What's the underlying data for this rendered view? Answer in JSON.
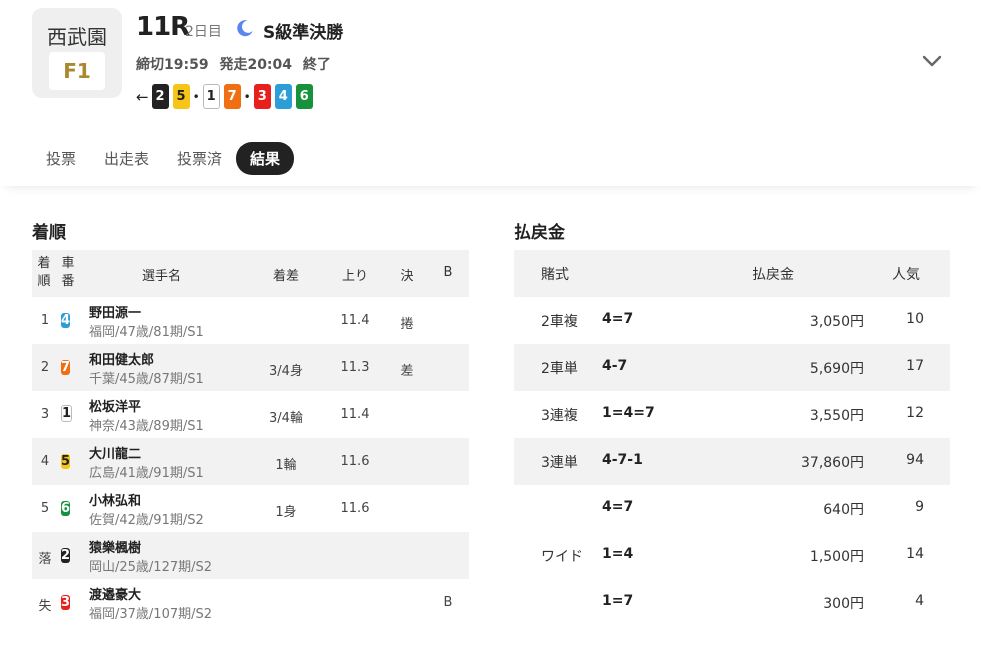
{
  "header": {
    "venue": "西武園",
    "grade": "F1",
    "race_no": "11R",
    "day": "2日目",
    "race_name": "S級準決勝",
    "deadline": "締切19:59",
    "start": "発走20:04",
    "status": "終了",
    "lineup_arrow": "←",
    "lineup": [
      {
        "car": "2",
        "color": "#222222"
      },
      {
        "car": "5",
        "color": "#f7c518"
      },
      {
        "sep": "•"
      },
      {
        "car": "1",
        "color": "#ffffff"
      },
      {
        "car": "7",
        "color": "#f06e14"
      },
      {
        "sep": "•"
      },
      {
        "car": "3",
        "color": "#e8201d"
      },
      {
        "car": "4",
        "color": "#2b9ed8"
      },
      {
        "car": "6",
        "color": "#17923c"
      }
    ]
  },
  "tabs": [
    "投票",
    "出走表",
    "投票済",
    "結果"
  ],
  "active_tab": "結果",
  "results": {
    "title": "着順",
    "headers": {
      "rank": "着\n順",
      "car": "車\n番",
      "name": "選手名",
      "margin": "着差",
      "last": "上り",
      "decision": "決",
      "b": "B"
    },
    "rows": [
      {
        "rank": "1",
        "car": "4",
        "name": "野田源一",
        "info": "福岡/47歳/81期/S1",
        "margin": "",
        "last": "11.4",
        "decision": "捲",
        "b": ""
      },
      {
        "rank": "2",
        "car": "7",
        "name": "和田健太郎",
        "info": "千葉/45歳/87期/S1",
        "margin": "3/4身",
        "last": "11.3",
        "decision": "差",
        "b": ""
      },
      {
        "rank": "3",
        "car": "1",
        "name": "松坂洋平",
        "info": "神奈/43歳/89期/S1",
        "margin": "3/4輪",
        "last": "11.4",
        "decision": "",
        "b": ""
      },
      {
        "rank": "4",
        "car": "5",
        "name": "大川龍二",
        "info": "広島/41歳/91期/S1",
        "margin": "1輪",
        "last": "11.6",
        "decision": "",
        "b": ""
      },
      {
        "rank": "5",
        "car": "6",
        "name": "小林弘和",
        "info": "佐賀/42歳/91期/S2",
        "margin": "1身",
        "last": "11.6",
        "decision": "",
        "b": ""
      },
      {
        "rank": "落",
        "car": "2",
        "name": "猿樂楓樹",
        "info": "岡山/25歳/127期/S2",
        "margin": "",
        "last": "",
        "decision": "",
        "b": ""
      },
      {
        "rank": "失",
        "car": "3",
        "name": "渡邉豪大",
        "info": "福岡/37歳/107期/S2",
        "margin": "",
        "last": "",
        "decision": "",
        "b": "B"
      }
    ]
  },
  "payouts": {
    "title": "払戻金",
    "headers": {
      "type": "賭式",
      "amount": "払戻金",
      "popularity": "人気"
    },
    "rows": [
      {
        "type": "2車複",
        "combo": "4=7",
        "amount": "3,050円",
        "popularity": "10"
      },
      {
        "type": "2車単",
        "combo": "4-7",
        "amount": "5,690円",
        "popularity": "17"
      },
      {
        "type": "3連複",
        "combo": "1=4=7",
        "amount": "3,550円",
        "popularity": "12"
      },
      {
        "type": "3連単",
        "combo": "4-7-1",
        "amount": "37,860円",
        "popularity": "94"
      },
      {
        "type": "",
        "combo": "4=7",
        "amount": "640円",
        "popularity": "9"
      },
      {
        "type": "ワイド",
        "combo": "1=4",
        "amount": "1,500円",
        "popularity": "14"
      },
      {
        "type": "",
        "combo": "1=7",
        "amount": "300円",
        "popularity": "4"
      }
    ]
  }
}
